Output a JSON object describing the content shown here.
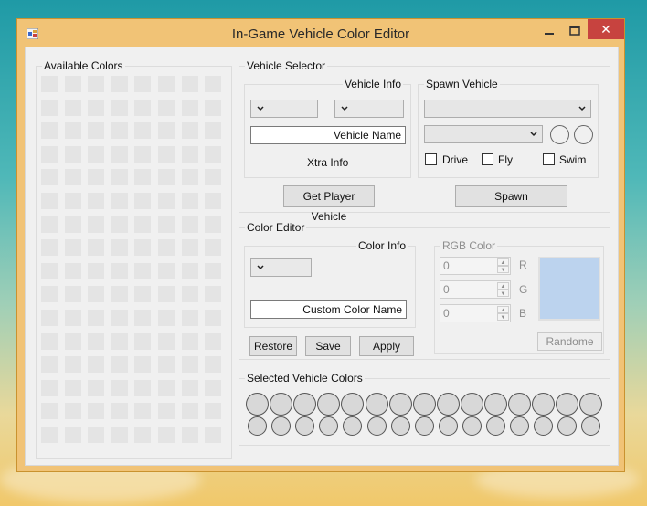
{
  "window": {
    "title": "In-Game Vehicle Color Editor",
    "close_glyph": "✕"
  },
  "available_colors": {
    "label": "Available Colors",
    "rows": 16,
    "cols": 8
  },
  "vehicle_selector": {
    "label": "Vehicle Selector",
    "vehicle_info": {
      "label": "Vehicle Info",
      "vehicle_name": "Vehicle Name",
      "xtra_info": "Xtra Info"
    },
    "get_player_vehicle": "Get Player Vehicle",
    "spawn_vehicle": {
      "label": "Spawn Vehicle",
      "drive": "Drive",
      "fly": "Fly",
      "swim": "Swim",
      "spawn": "Spawn"
    }
  },
  "color_editor": {
    "label": "Color Editor",
    "color_info": {
      "label": "Color Info",
      "custom_color_name": "Custom Color Name"
    },
    "restore": "Restore",
    "save": "Save",
    "apply": "Apply",
    "rgb": {
      "label": "RGB Color",
      "r_label": "R",
      "g_label": "G",
      "b_label": "B",
      "r_value": "0",
      "g_value": "0",
      "b_value": "0",
      "preview_color": "#bcd3ee",
      "random": "Randome"
    }
  },
  "selected_vehicle_colors": {
    "label": "Selected Vehicle Colors",
    "large_count": 15,
    "small_count": 15
  },
  "colors": {
    "close_red": "#c7433f",
    "window_frame": "#f1c376",
    "client_bg": "#f0f0f0"
  }
}
